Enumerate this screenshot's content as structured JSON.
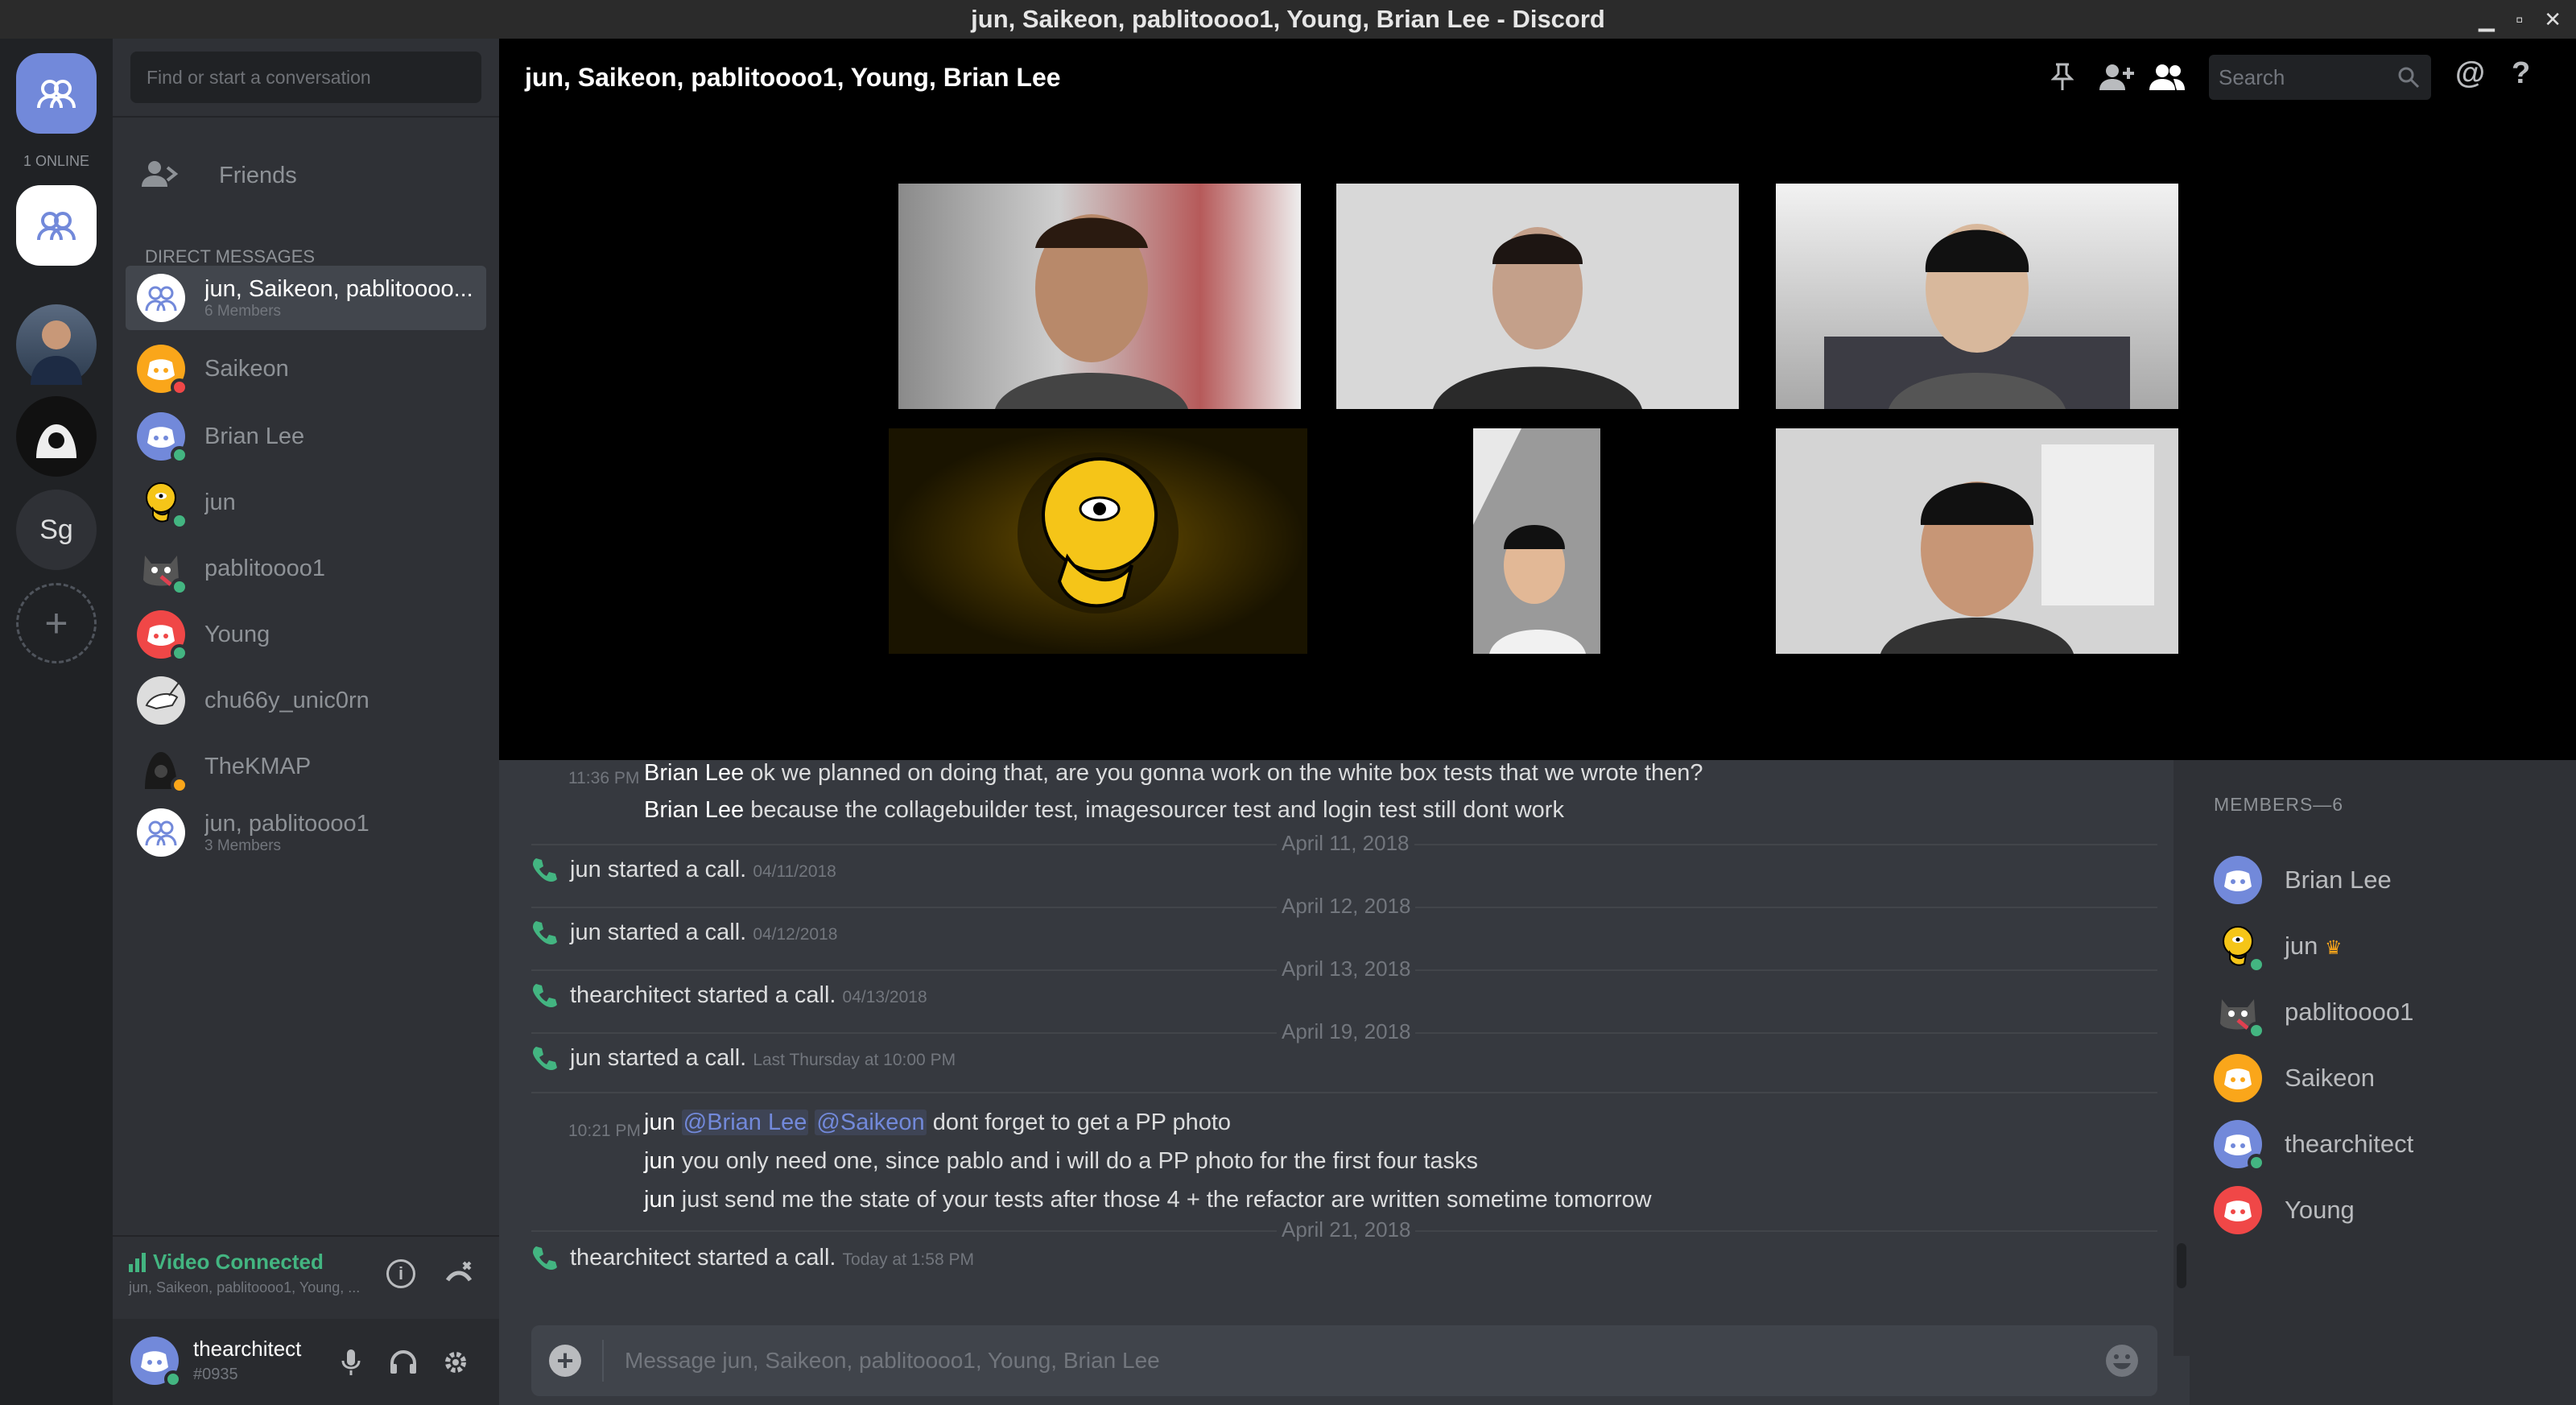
{
  "window": {
    "title": "jun, Saikeon, pablitoooo1, Young, Brian Lee - Discord",
    "minimize": "▁",
    "maximize": "▫",
    "close": "✕"
  },
  "guilds": {
    "online_label": "1 ONLINE",
    "server_initials": "Sg",
    "add_label": "+"
  },
  "sidebar": {
    "search_placeholder": "Find or start a conversation",
    "friends_label": "Friends",
    "dm_header": "DIRECT MESSAGES",
    "dms": [
      {
        "name": "jun, Saikeon, pablitoooo...",
        "sub": "6 Members",
        "avatar": "group-icon",
        "color": "#7289da",
        "status": ""
      },
      {
        "name": "Saikeon",
        "sub": "",
        "avatar": "discord-icon",
        "color": "#faa61a",
        "status": "#f04747"
      },
      {
        "name": "Brian Lee",
        "sub": "",
        "avatar": "discord-icon",
        "color": "#7289da",
        "status": "#43b581"
      },
      {
        "name": "jun",
        "sub": "",
        "avatar": "yellow-face-icon",
        "color": "#f5c518",
        "status": "#43b581"
      },
      {
        "name": "pablitoooo1",
        "sub": "",
        "avatar": "cat-icon",
        "color": "#555",
        "status": "#43b581"
      },
      {
        "name": "Young",
        "sub": "",
        "avatar": "discord-icon",
        "color": "#f04747",
        "status": "#43b581"
      },
      {
        "name": "chu66y_unic0rn",
        "sub": "",
        "avatar": "unicorn-icon",
        "color": "#ddd",
        "status": ""
      },
      {
        "name": "TheKMAP",
        "sub": "",
        "avatar": "hacker-icon",
        "color": "#222",
        "status": "#faa61a"
      },
      {
        "name": "jun, pablitoooo1",
        "sub": "3 Members",
        "avatar": "group-icon",
        "color": "#7289da",
        "status": ""
      }
    ],
    "voice": {
      "status": "Video Connected",
      "channel": "jun, Saikeon, pablitoooo1, Young, ..."
    },
    "user": {
      "name": "thearchitect",
      "tag": "#0935"
    }
  },
  "header": {
    "title": "jun, Saikeon, pablitoooo1, Young, Brian Lee",
    "search_placeholder": "Search"
  },
  "chat": {
    "messages": [
      {
        "time": "11:36 PM",
        "author": "Brian Lee",
        "text": "ok we planned on doing that, are you gonna work on the white box tests that we wrote then?"
      },
      {
        "author": "Brian Lee",
        "text": "because the collagebuilder test, imagesourcer test and login test still dont work"
      }
    ],
    "dates": [
      "April 11, 2018",
      "April 12, 2018",
      "April 13, 2018",
      "April 19, 2018",
      "April 21, 2018"
    ],
    "calls": [
      {
        "user": "jun",
        "text": "started a call.",
        "time": "04/11/2018"
      },
      {
        "user": "jun",
        "text": "started a call.",
        "time": "04/12/2018"
      },
      {
        "user": "thearchitect",
        "text": "started a call.",
        "time": "04/13/2018"
      },
      {
        "user": "jun",
        "text": "started a call.",
        "time": "Last Thursday at 10:00 PM"
      },
      {
        "user": "thearchitect",
        "text": "started a call.",
        "time": "Today at 1:58 PM"
      }
    ],
    "jun_msgs": {
      "time": "10:21 PM",
      "author": "jun",
      "mention1": "@Brian Lee",
      "mention2": "@Saikeon",
      "text1": "dont forget to get a PP photo",
      "text2": "you only need one, since pablo and i will do a PP photo for the first four tasks",
      "text3": "just send me the state of your tests after those 4 + the refactor are written sometime tomorrow"
    },
    "input_placeholder": "Message jun, Saikeon, pablitoooo1, Young, Brian Lee"
  },
  "members": {
    "header": "MEMBERS—6",
    "list": [
      {
        "name": "Brian Lee",
        "color": "#7289da"
      },
      {
        "name": "jun",
        "color": "#f5c518",
        "crown": "♛"
      },
      {
        "name": "pablitoooo1",
        "color": "#555"
      },
      {
        "name": "Saikeon",
        "color": "#faa61a"
      },
      {
        "name": "thearchitect",
        "color": "#7289da"
      },
      {
        "name": "Young",
        "color": "#f04747"
      }
    ]
  },
  "colors": {
    "accent": "#7289da",
    "online": "#43b581",
    "dnd": "#f04747",
    "idle": "#faa61a"
  }
}
